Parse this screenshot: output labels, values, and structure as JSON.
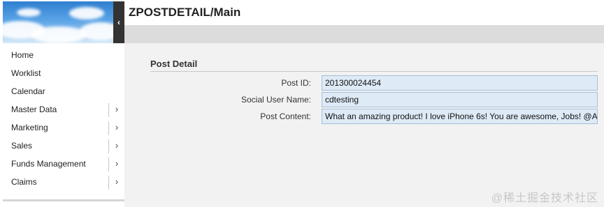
{
  "header": {
    "title": "ZPOSTDETAIL/Main"
  },
  "sidebar": {
    "items": [
      {
        "label": "Home",
        "has_submenu": false
      },
      {
        "label": "Worklist",
        "has_submenu": false
      },
      {
        "label": "Calendar",
        "has_submenu": false
      },
      {
        "label": "Master Data",
        "has_submenu": true
      },
      {
        "label": "Marketing",
        "has_submenu": true
      },
      {
        "label": "Sales",
        "has_submenu": true
      },
      {
        "label": "Funds Management",
        "has_submenu": true
      },
      {
        "label": "Claims",
        "has_submenu": true
      }
    ]
  },
  "main": {
    "section_title": "Post Detail",
    "fields": {
      "post_id": {
        "label": "Post ID:",
        "value": "201300024454"
      },
      "social_user_name": {
        "label": "Social User Name:",
        "value": "cdtesting"
      },
      "post_content": {
        "label": "Post Content:",
        "value": "What an amazing product! I love iPhone 6s! You are awesome, Jobs! @A"
      }
    }
  },
  "watermark": "@稀土掘金技术社区",
  "colors": {
    "field_bg": "#deeaf6",
    "field_border": "#a7bfd6",
    "header_bar": "#dcdcdc",
    "collapse_bg": "#333333"
  },
  "icons": {
    "collapse": "chevron-left-icon",
    "submenu": "chevron-right-icon"
  }
}
